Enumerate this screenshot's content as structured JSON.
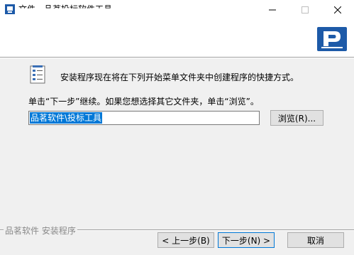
{
  "window": {
    "title": "文件 - 品茗投标软件工具"
  },
  "content": {
    "intro_text": "安装程序现在将在下列开始菜单文件夹中创建程序的快捷方式。",
    "instruction_text": "单击“下一步”继续。如果您想选择其它文件夹，单击“浏览”。",
    "folder_value": "品茗软件\\投标工具"
  },
  "buttons": {
    "browse": "浏览(R)...",
    "back": "< 上一步(B)",
    "next": "下一步(N) >",
    "cancel": "取消"
  },
  "footer": {
    "brand_text": "品茗软件 安装程序"
  },
  "colors": {
    "accent": "#0078d7",
    "logo_blue": "#1d5aa8"
  },
  "icons": {
    "app": "installer-app-icon",
    "logo": "pinming-p-logo",
    "shortcut": "shortcut-list-icon"
  }
}
